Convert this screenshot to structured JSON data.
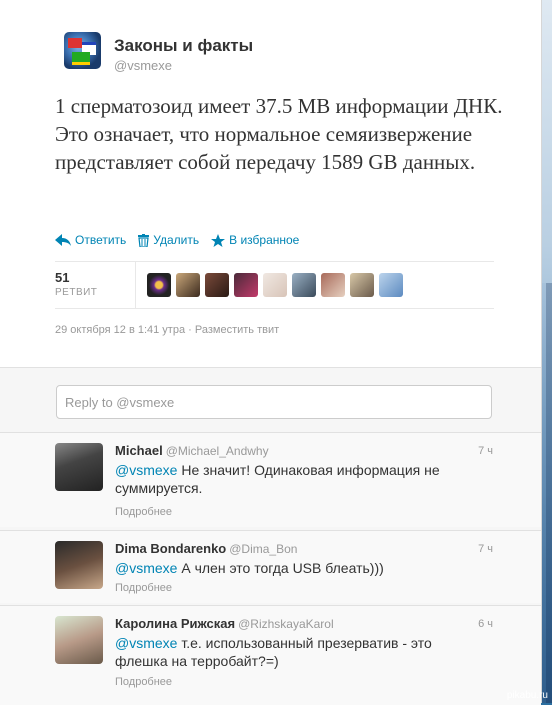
{
  "account": {
    "name": "Законы и факты",
    "handle": "@vsmexe"
  },
  "tweet": {
    "text": "1 сперматозоид имеет 37.5 MB информации ДНК. Это означает, что нормальное семяизвержение представляет собой передачу 1589 GB данных.",
    "actions": {
      "reply": "Ответить",
      "delete": "Удалить",
      "favorite": "В избранное"
    },
    "retweet_count": "51",
    "retweet_label": "РЕТВИТ",
    "timestamp": "29 октября 12 в 1:41 утра",
    "separator": "·",
    "embed": "Разместить твит"
  },
  "reply_box": {
    "placeholder": "Reply to @vsmexe"
  },
  "replies": [
    {
      "name": "Michael",
      "handle": "@Michael_Andwhy",
      "time": "7 ч",
      "mention": "@vsmexe",
      "text": " Не значит! Одинаковая информация не суммируется.",
      "more": "Подробнее"
    },
    {
      "name": "Dima Bondarenko",
      "handle": "@Dima_Bon",
      "time": "7 ч",
      "mention": "@vsmexe",
      "text": " А член это тогда USB блеать)))",
      "more": "Подробнее"
    },
    {
      "name": "Каролина Рижская",
      "handle": "@RizhskayaKarol",
      "time": "6 ч",
      "mention": "@vsmexe",
      "text": " т.е. использованный презерватив - это флешка на терробайт?=)",
      "more": "Подробнее"
    }
  ],
  "watermark": "pikabu.ru",
  "colors": {
    "link": "#0084b4",
    "text": "#333333",
    "muted": "#999999"
  }
}
